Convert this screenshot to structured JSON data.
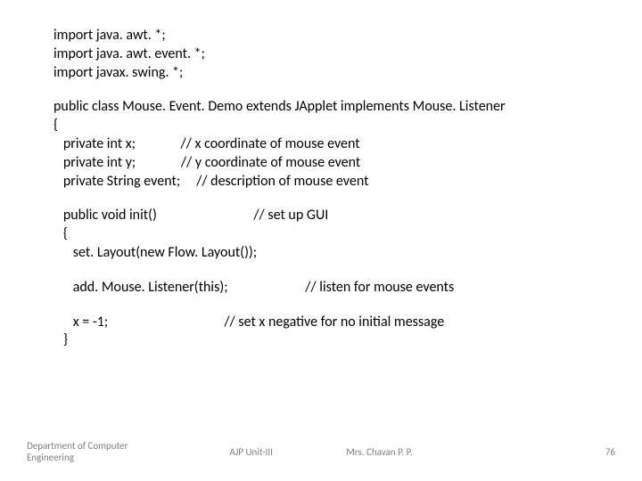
{
  "code": {
    "l1": "import java. awt. *;",
    "l2": "import java. awt. event. *;",
    "l3": "import javax. swing. *;",
    "l4": "public class Mouse. Event. Demo extends JApplet implements Mouse. Listener",
    "l5": "{",
    "l6": "   private int x;              // x coordinate of mouse event",
    "l7": "   private int y;              // y coordinate of mouse event",
    "l8": "   private String event;     // description of mouse event",
    "l9": "   public void init()                              // set up GUI",
    "l10": "   {",
    "l11": "      set. Layout(new Flow. Layout());",
    "l12": "      add. Mouse. Listener(this);                        // listen for mouse events",
    "l13": "      x = -1;                                    // set x negative for no initial message",
    "l14": "   }"
  },
  "footer": {
    "dept1": "Department of Computer",
    "dept2": "Engineering",
    "unit": "AJP Unit-III",
    "author": "Mrs. Chavan P. P.",
    "page": "76"
  }
}
